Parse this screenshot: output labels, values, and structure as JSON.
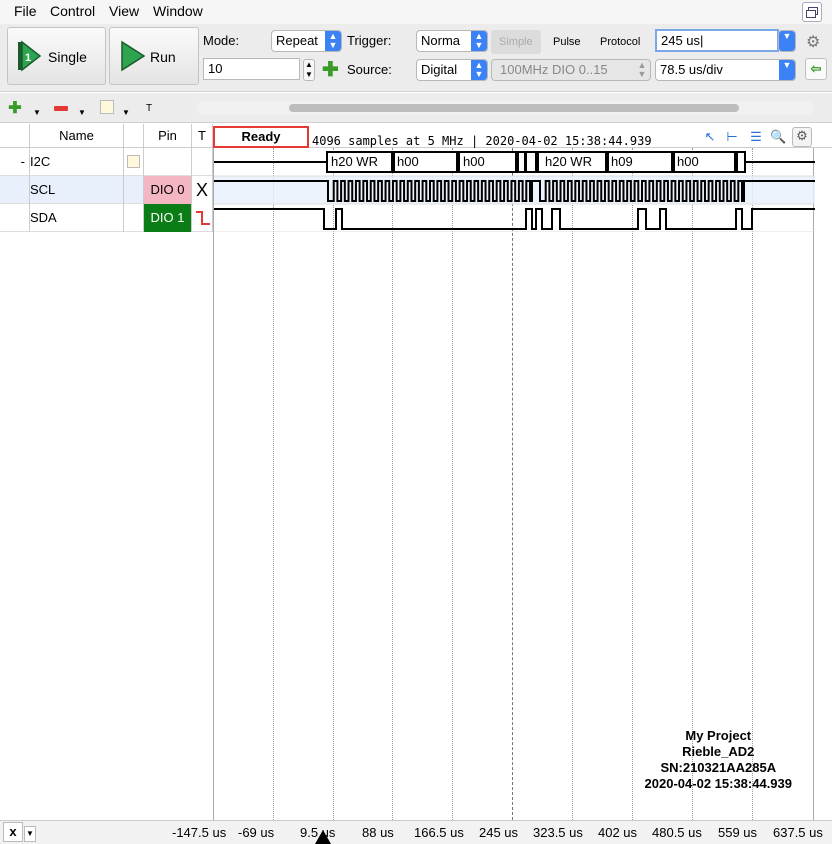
{
  "menu": {
    "items": [
      "File",
      "Control",
      "View",
      "Window"
    ]
  },
  "toolbar": {
    "single_label": "Single",
    "run_label": "Run",
    "mode_label": "Mode:",
    "mode_value": "Repeat",
    "trigger_label": "Trigger:",
    "trigger_value": "Norma",
    "tabs": [
      "Simple",
      "Pulse",
      "Protocol"
    ],
    "position_value": "245 us",
    "count_value": "10",
    "source_label": "Source:",
    "source_value": "Digital",
    "source_channel": "100MHz DIO 0..15",
    "timebase_value": "78.5 us/div"
  },
  "grid": {
    "columns": [
      "Name",
      "Pin",
      "T"
    ],
    "status": "Ready",
    "samples_info": "4096 samples at 5 MHz | 2020-04-02 15:38:44.939",
    "rows": [
      {
        "prefix": "-",
        "name": "I2C",
        "pin": "",
        "trigger": ""
      },
      {
        "prefix": "",
        "name": "SCL",
        "pin": "DIO 0",
        "trigger": "X"
      },
      {
        "prefix": "",
        "name": "SDA",
        "pin": "DIO 1",
        "trigger": ""
      }
    ],
    "bus_labels": [
      "h20 WR",
      "h00",
      "h00",
      "h20 WR",
      "h09",
      "h00"
    ]
  },
  "info": {
    "project": "My Project",
    "device": "Rieble_AD2",
    "serial": "SN:210321AA285A",
    "timestamp": "2020-04-02 15:38:44.939"
  },
  "axis": {
    "ticks": [
      "-147.5 us",
      "-69 us",
      "9.5 us",
      "88 us",
      "166.5 us",
      "245 us",
      "323.5 us",
      "402 us",
      "480.5 us",
      "559 us",
      "637.5 us"
    ],
    "x_button": "x"
  },
  "colors": {
    "scl_pin_bg": "#f4b6c2",
    "sda_pin_bg": "#0a7d16",
    "ready_border": "#e53935",
    "accent": "#3b82f6"
  }
}
